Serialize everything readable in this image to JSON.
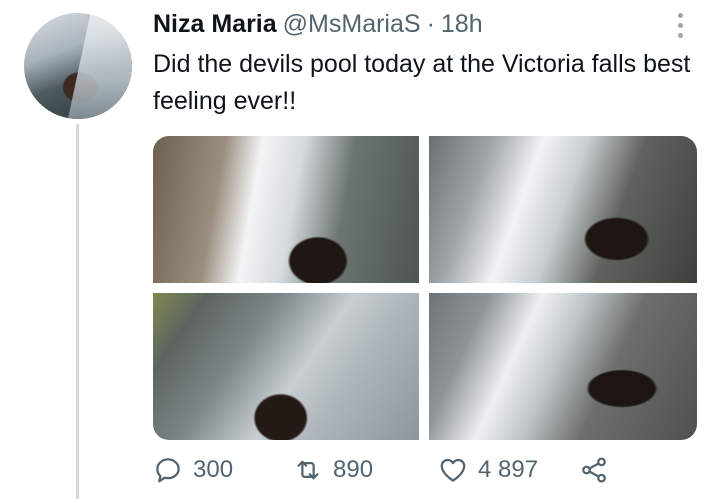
{
  "tweet": {
    "author_name": "Niza Maria",
    "author_handle": "@MsMariaS",
    "separator": "·",
    "time_ago": "18h",
    "text": "Did the devils pool today at the Victoria falls best feeling ever!!"
  },
  "actions": {
    "reply_count": "300",
    "retweet_count": "890",
    "like_count": "4 897"
  },
  "icons": {
    "more": "more-vertical-icon",
    "reply": "reply-icon",
    "retweet": "retweet-icon",
    "like": "heart-icon",
    "share": "share-icon"
  },
  "colors": {
    "text": "#0f1419",
    "secondary": "#536471",
    "thread_line": "#cfd9de"
  }
}
